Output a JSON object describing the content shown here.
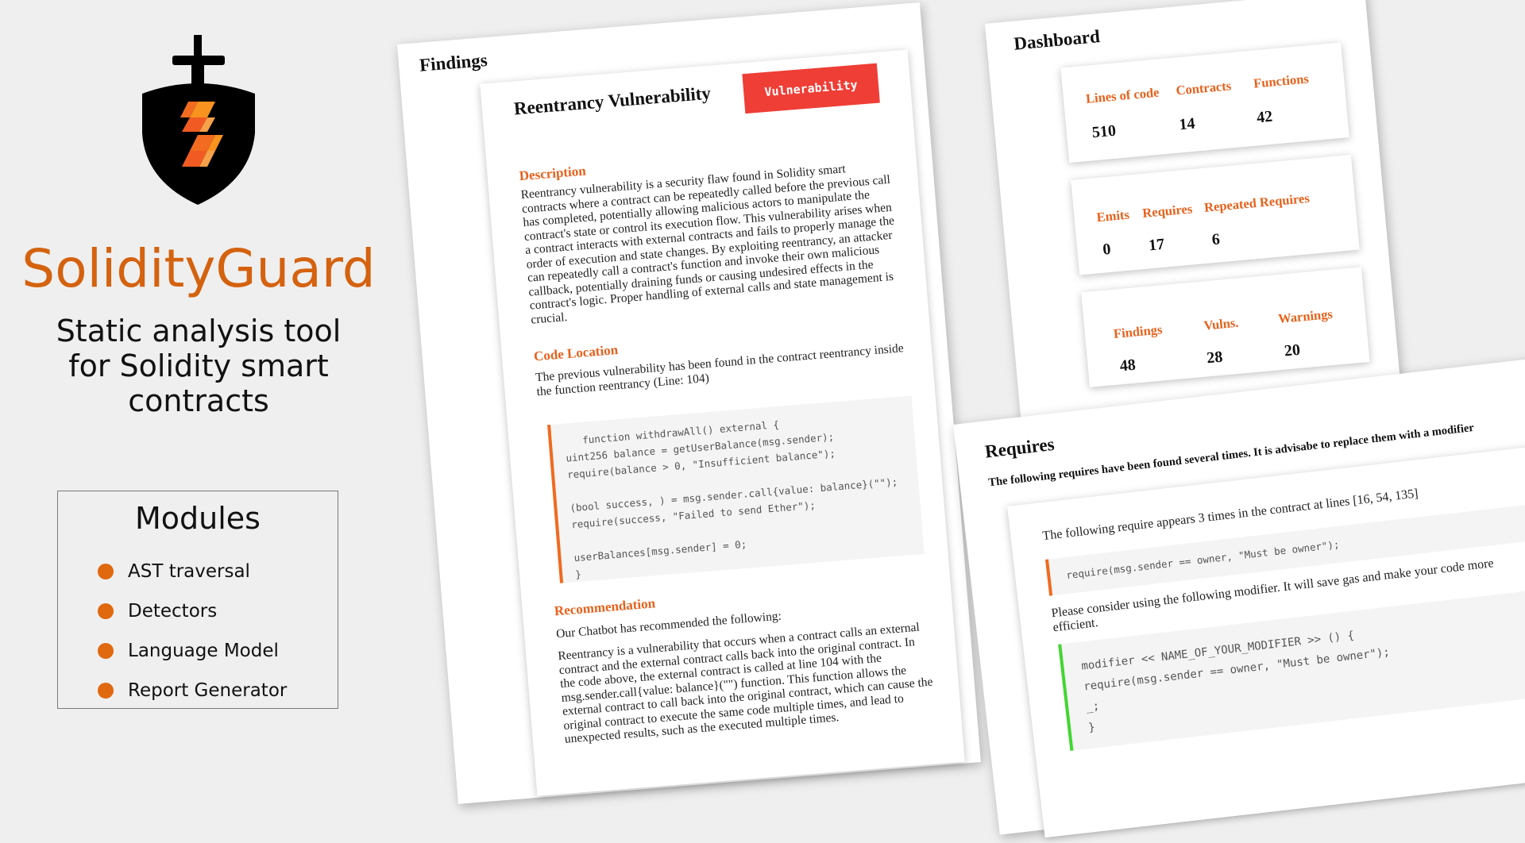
{
  "brand": {
    "name": "SolidityGuard",
    "tagline": "Static analysis tool for Solidity smart contracts",
    "logo_icon": "shield-sword-icon",
    "accent_color": "#d4620f"
  },
  "modules": {
    "title": "Modules",
    "items": [
      "AST traversal",
      "Detectors",
      "Language Model",
      "Report Generator"
    ]
  },
  "findings_page": {
    "title": "Findings",
    "finding": {
      "title": "Reentrancy Vulnerability",
      "badge": "Vulnerability",
      "badge_color": "#ef3e36",
      "description_title": "Description",
      "description": "Reentrancy vulnerability is a security flaw found in Solidity smart contracts where a contract can be repeatedly called before the previous call has completed, potentially allowing malicious actors to manipulate the contract's state or control its execution flow. This vulnerability arises when a contract interacts with external contracts and fails to properly manage the order of execution and state changes. By exploiting reentrancy, an attacker can repeatedly call a contract's function and invoke their own malicious callback, potentially draining funds or causing undesired effects in the contract's logic. Proper handling of external calls and state management is crucial.",
      "location_title": "Code Location",
      "location_text": "The previous vulnerability has been found in the contract reentrancy inside the function reentrancy (Line: 104)",
      "code": "   function withdrawAll() external {\nuint256 balance = getUserBalance(msg.sender);\nrequire(balance > 0, \"Insufficient balance\");\n\n(bool success, ) = msg.sender.call{value: balance}(\"\");\nrequire(success, \"Failed to send Ether\");\n\nuserBalances[msg.sender] = 0;\n}",
      "recommendation_title": "Recommendation",
      "recommendation_intro": "Our Chatbot has recommended the following:",
      "recommendation_text": "Reentrancy is a vulnerability that occurs when a contract calls an external contract and the external contract calls back into the original contract. In the code above, the external contract is called at line 104 with the msg.sender.call{value: balance}(\"\") function. This function allows the external contract to call back into the original contract, which can cause the original contract to execute the same code multiple times, and lead to unexpected results, such as the executed multiple times."
    }
  },
  "dashboard_page": {
    "title": "Dashboard",
    "cards": [
      {
        "stats": [
          {
            "label": "Lines of code",
            "value": "510"
          },
          {
            "label": "Contracts",
            "value": "14"
          },
          {
            "label": "Functions",
            "value": "42"
          }
        ]
      },
      {
        "stats": [
          {
            "label": "Emits",
            "value": "0"
          },
          {
            "label": "Requires",
            "value": "17"
          },
          {
            "label": "Repeated Requires",
            "value": "6"
          }
        ]
      },
      {
        "stats": [
          {
            "label": "Findings",
            "value": "48"
          },
          {
            "label": "Vulns.",
            "value": "28"
          },
          {
            "label": "Warnings",
            "value": "20"
          }
        ]
      }
    ]
  },
  "requires_page": {
    "title": "Requires",
    "subtitle": "The following requires have been found several times. It is advisabe to replace them with a modifier",
    "appears_text": "The following require appears 3 times in the contract at lines [16, 54, 135]",
    "require_code": "require(msg.sender == owner, \"Must be owner\");",
    "modifier_text": "Please consider using the following modifier. It will save gas and make your code more efficient.",
    "modifier_code": "modifier << NAME_OF_YOUR_MODIFIER >> () {\nrequire(msg.sender == owner, \"Must be owner\");\n_;\n}"
  }
}
